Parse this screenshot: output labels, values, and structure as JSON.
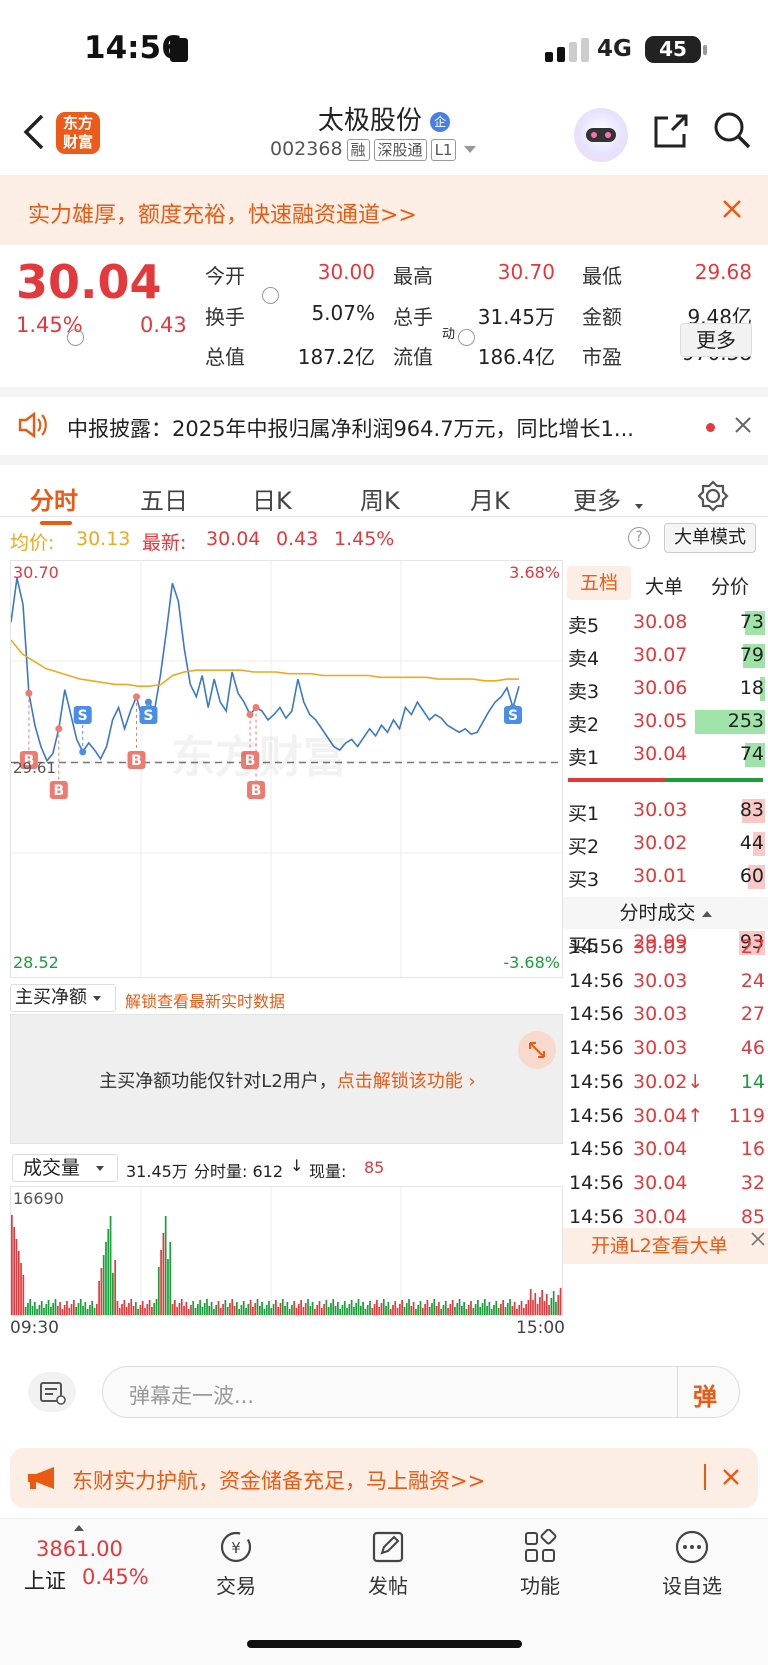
{
  "status": {
    "time": "14:56",
    "network": "4G",
    "battery": "45"
  },
  "header": {
    "stock_name": "太极股份",
    "badge": "企",
    "code": "002368",
    "tags": [
      "融",
      "深股通",
      "L1"
    ]
  },
  "banner_top": {
    "text": "实力雄厚，额度充裕，快速融资通道>>"
  },
  "quote": {
    "price": "30.04",
    "pct": "1.45%",
    "change": "0.43",
    "fields": [
      {
        "label": "今开",
        "value": "30.00",
        "color": "red"
      },
      {
        "label": "最高",
        "value": "30.70",
        "color": "red"
      },
      {
        "label": "最低",
        "value": "29.68",
        "color": "red"
      },
      {
        "label": "换手",
        "value": "5.07%",
        "color": "dark"
      },
      {
        "label": "总手",
        "value": "31.45万",
        "color": "dark"
      },
      {
        "label": "金额",
        "value": "9.48亿",
        "color": "dark"
      },
      {
        "label": "总值",
        "value": "187.2亿",
        "color": "dark"
      },
      {
        "label": "流值",
        "value": "186.4亿",
        "color": "dark"
      },
      {
        "label": "市盈",
        "value": "970.38",
        "color": "dark"
      }
    ],
    "pe_sup": "动",
    "more": "更多"
  },
  "news": {
    "text": "中报披露：2025年中报归属净利润964.7万元，同比增长1..."
  },
  "tabs": [
    "分时",
    "五日",
    "日K",
    "周K",
    "月K",
    "更多"
  ],
  "info": {
    "avg_label": "均价:",
    "avg": "30.13",
    "latest_label": "最新:",
    "latest": "30.04",
    "chg": "0.43",
    "pct": "1.45%",
    "mode": "大单模式"
  },
  "chart_data": {
    "type": "line",
    "y_top": "30.70",
    "y_bottom": "28.52",
    "y_mid": "29.61",
    "pct_top": "3.68%",
    "pct_bottom": "-3.68%",
    "ylim": [
      28.52,
      30.7
    ],
    "prev_close": 29.61,
    "price": [
      30.4,
      30.65,
      30.5,
      30.0,
      29.82,
      29.7,
      29.62,
      29.66,
      29.8,
      30.02,
      29.88,
      29.74,
      29.67,
      29.72,
      29.68,
      29.63,
      29.7,
      29.85,
      29.92,
      29.8,
      29.9,
      29.98,
      29.85,
      29.95,
      29.9,
      30.1,
      30.35,
      30.62,
      30.52,
      30.25,
      30.05,
      29.98,
      30.1,
      29.92,
      30.08,
      29.95,
      29.9,
      30.12,
      30.0,
      29.95,
      29.88,
      29.92,
      29.9,
      29.85,
      29.88,
      29.92,
      29.86,
      29.9,
      30.08,
      29.95,
      29.88,
      29.85,
      29.8,
      29.75,
      29.7,
      29.68,
      29.72,
      29.74,
      29.7,
      29.75,
      29.8,
      29.76,
      29.82,
      29.78,
      29.85,
      29.8,
      29.92,
      29.88,
      29.95,
      29.9,
      29.85,
      29.88,
      29.86,
      29.82,
      29.8,
      29.78,
      29.8,
      29.77,
      29.78,
      29.84,
      29.9,
      29.95,
      29.98,
      30.03,
      29.92,
      30.04
    ],
    "avg": [
      30.3,
      30.22,
      30.18,
      30.14,
      30.12,
      30.1,
      30.08,
      30.07,
      30.06,
      30.05,
      30.05,
      30.04,
      30.04,
      30.05,
      30.1,
      30.12,
      30.13,
      30.13,
      30.13,
      30.13,
      30.13,
      30.12,
      30.12,
      30.12,
      30.11,
      30.11,
      30.11,
      30.1,
      30.1,
      30.1,
      30.1,
      30.1,
      30.09,
      30.09,
      30.09,
      30.09,
      30.09,
      30.08,
      30.08,
      30.08,
      30.08,
      30.07,
      30.07,
      30.08,
      30.08
    ],
    "markers": [
      {
        "t": "B",
        "i": 3
      },
      {
        "t": "B",
        "i": 8
      },
      {
        "t": "S",
        "i": 12
      },
      {
        "t": "B",
        "i": 21
      },
      {
        "t": "S",
        "i": 23
      },
      {
        "t": "B",
        "i": 40
      },
      {
        "t": "B",
        "i": 41
      },
      {
        "t": "S",
        "i": 84
      }
    ],
    "watermark": "东方财富"
  },
  "orderbook": {
    "tabs": [
      "五档",
      "大单",
      "分价"
    ],
    "asks": [
      {
        "label": "卖5",
        "price": "30.08",
        "vol": "73",
        "w": 0.29
      },
      {
        "label": "卖4",
        "price": "30.07",
        "vol": "79",
        "w": 0.31
      },
      {
        "label": "卖3",
        "price": "30.06",
        "vol": "18",
        "w": 0.07
      },
      {
        "label": "卖2",
        "price": "30.05",
        "vol": "253",
        "w": 1.0
      },
      {
        "label": "卖1",
        "price": "30.04",
        "vol": "74",
        "w": 0.29
      }
    ],
    "bids": [
      {
        "label": "买1",
        "price": "30.03",
        "vol": "83",
        "w": 0.33
      },
      {
        "label": "买2",
        "price": "30.02",
        "vol": "44",
        "w": 0.17
      },
      {
        "label": "买3",
        "price": "30.01",
        "vol": "60",
        "w": 0.24
      },
      {
        "label": "买4",
        "price": "30.00",
        "vol": "230",
        "w": 0.91
      },
      {
        "label": "买5",
        "price": "29.99",
        "vol": "93",
        "w": 0.37
      }
    ]
  },
  "ticks": {
    "title": "分时成交",
    "rows": [
      {
        "t": "14:56",
        "p": "30.03",
        "v": "27",
        "pc": "red",
        "vc": "red"
      },
      {
        "t": "14:56",
        "p": "30.03",
        "v": "24",
        "pc": "red",
        "vc": "red"
      },
      {
        "t": "14:56",
        "p": "30.03",
        "v": "27",
        "pc": "red",
        "vc": "red"
      },
      {
        "t": "14:56",
        "p": "30.03",
        "v": "46",
        "pc": "red",
        "vc": "red"
      },
      {
        "t": "14:56",
        "p": "30.02↓",
        "v": "14",
        "pc": "red",
        "vc": "green"
      },
      {
        "t": "14:56",
        "p": "30.04↑",
        "v": "119",
        "pc": "red",
        "vc": "red"
      },
      {
        "t": "14:56",
        "p": "30.04",
        "v": "16",
        "pc": "red",
        "vc": "red"
      },
      {
        "t": "14:56",
        "p": "30.04",
        "v": "32",
        "pc": "red",
        "vc": "red"
      },
      {
        "t": "14:56",
        "p": "30.04",
        "v": "85",
        "pc": "red",
        "vc": "red"
      }
    ],
    "promo": "开通L2查看大单"
  },
  "netflow": {
    "select": "主买净额",
    "unlock": "解锁查看最新实时数据",
    "notice": "主买净额功能仅针对L2用户，",
    "notice_link": "点击解锁该功能"
  },
  "volume": {
    "select": "成交量",
    "total": "31.45万",
    "fs_label": "分时量: 612",
    "now_label": "现量:",
    "now": "85",
    "ymax": "16690",
    "x_start": "09:30",
    "x_end": "15:00"
  },
  "danmu": {
    "placeholder": "弹幕走一波...",
    "btn": "弹"
  },
  "banner_bottom": {
    "text": "东财实力护航，资金储备充足，马上融资>>"
  },
  "nav": {
    "index_value": "3861.00",
    "index_name": "上证",
    "index_pct": "0.45%",
    "items": [
      "交易",
      "发帖",
      "功能",
      "设自选"
    ]
  }
}
